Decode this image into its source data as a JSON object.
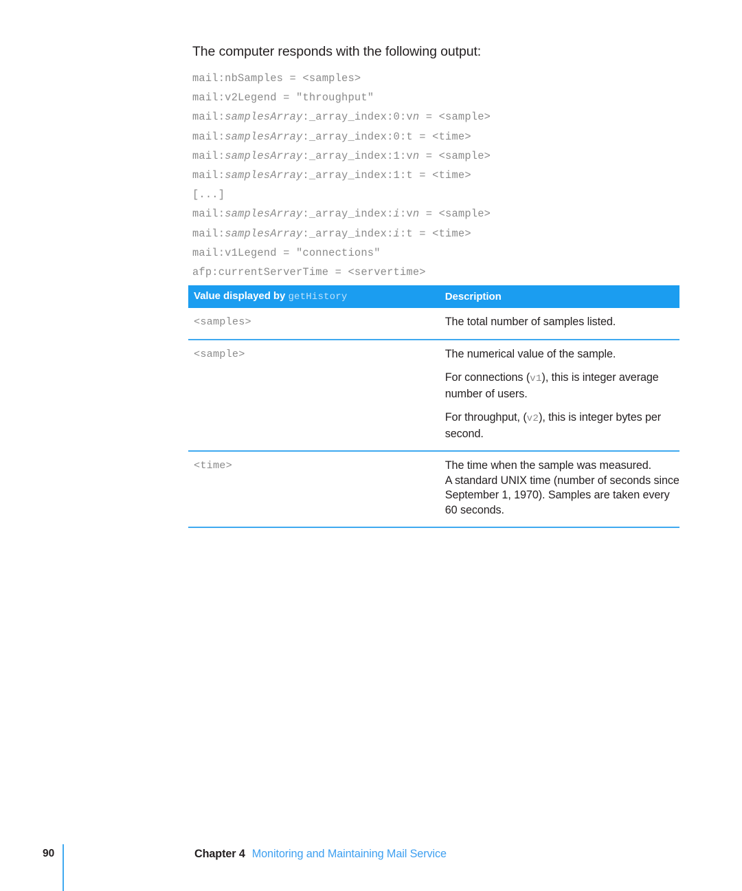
{
  "body": {
    "intro": "The computer responds with the following output:",
    "code_lines": [
      {
        "pre": "mail:nbSamples = <samples>",
        "italic": "",
        "post": ""
      },
      {
        "pre": "mail:v2Legend = \"throughput\"",
        "italic": "",
        "post": ""
      },
      {
        "pre": "mail:",
        "italic": "samplesArray",
        "post": ":_array_index:0:v",
        "italic2": "n",
        "post2": " = <sample>"
      },
      {
        "pre": "mail:",
        "italic": "samplesArray",
        "post": ":_array_index:0:t = <time>",
        "italic2": "",
        "post2": ""
      },
      {
        "pre": "mail:",
        "italic": "samplesArray",
        "post": ":_array_index:1:v",
        "italic2": "n",
        "post2": " = <sample>"
      },
      {
        "pre": "mail:",
        "italic": "samplesArray",
        "post": ":_array_index:1:t = <time>",
        "italic2": "",
        "post2": ""
      },
      {
        "pre": "[...]",
        "italic": "",
        "post": ""
      },
      {
        "pre": "mail:",
        "italic": "samplesArray",
        "post": ":_array_index:",
        "italic2": "i",
        "post2": ":v",
        "italic3": "n",
        "post3": " = <sample>"
      },
      {
        "pre": "mail:",
        "italic": "samplesArray",
        "post": ":_array_index:",
        "italic2": "i",
        "post2": ":t = <time>",
        "italic3": "",
        "post3": ""
      },
      {
        "pre": "mail:v1Legend = \"connections\"",
        "italic": "",
        "post": ""
      },
      {
        "pre": "afp:currentServerTime = <servertime>",
        "italic": "",
        "post": ""
      }
    ]
  },
  "table": {
    "header": {
      "col1_label": "Value displayed by",
      "col1_mono": "getHistory",
      "col2_label": "Description"
    },
    "rows": [
      {
        "value": "<samples>",
        "paragraphs": [
          {
            "before": "The total number of samples listed.",
            "mono": "",
            "after": ""
          }
        ]
      },
      {
        "value": "<sample>",
        "paragraphs": [
          {
            "before": "The numerical value of the sample.",
            "mono": "",
            "after": ""
          },
          {
            "before": "For connections (",
            "mono": "v1",
            "after": "), this is integer average number of users."
          },
          {
            "before": "For throughput, (",
            "mono": "v2",
            "after": "), this is integer bytes per second."
          }
        ]
      },
      {
        "value": "<time>",
        "paragraphs": [
          {
            "before": "The time when the sample was measured.",
            "mono": "",
            "after": "",
            "tight": true
          },
          {
            "before": "A standard UNIX time (number of seconds since September 1, 1970). Samples are taken every 60 seconds.",
            "mono": "",
            "after": ""
          }
        ]
      }
    ]
  },
  "footer": {
    "page_number": "90",
    "chapter_label": "Chapter 4",
    "chapter_title": "Monitoring and Maintaining Mail Service"
  },
  "colors": {
    "accent_blue": "#1b9df0",
    "rule_blue": "#3fa9f0",
    "link_blue": "#3d9ff0",
    "code_gray": "#8a8a8a",
    "text_black": "#231f20"
  }
}
